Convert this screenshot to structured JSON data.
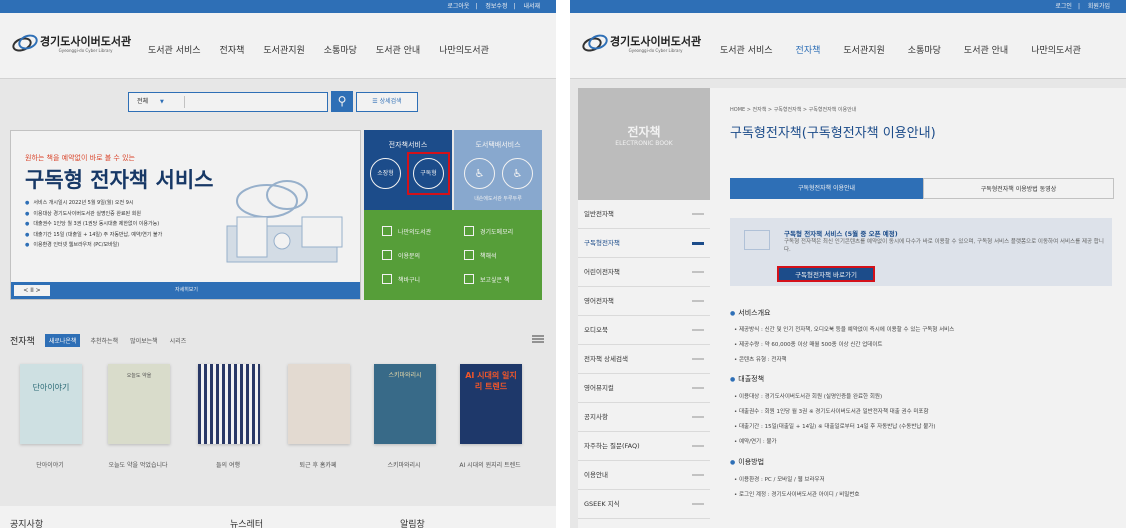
{
  "left": {
    "topbar": [
      "로그아웃",
      "정보수정",
      "내서재"
    ],
    "logo": {
      "name": "경기도사이버도서관",
      "sub": "Gyeonggi-do Cyber Library"
    },
    "gnb": [
      "도서관 서비스",
      "전자책",
      "도서관지원",
      "소통마당",
      "도서관 안내",
      "나만의도서관"
    ],
    "search": {
      "scope": "전체",
      "advanced": "상세검색"
    },
    "banner": {
      "kicker": "원하는 책을 예약없이 바로 볼 수 있는",
      "title": "구독형 전자책 서비스",
      "bullets": [
        "서비스 개시일시 2022년 5월 9일(월) 오전 9시",
        "이용대상 경기도사이버도서관 실명인증 완료된 회원",
        "대출권수 1인당 월 3권 (1권당 동시대출 제한없이 이용가능)",
        "대출기간 15일 (대출일 + 14일) 주 자동반납, 예약/연기 불가",
        "이용환경 인터넷 웹브라우저 (PC/모바일)"
      ],
      "nav": "< II >",
      "more": "자세히보기"
    },
    "ebook_service": {
      "title": "전자책서비스",
      "btn1": "소장형",
      "btn2": "구독형"
    },
    "delivery": {
      "title": "도서택배서비스",
      "caption": "내손에도서관  두루두루"
    },
    "quick": [
      "나만의도서관",
      "경기도메모리",
      "이용문의",
      "책해석",
      "책바구니",
      "보고싶은 책"
    ],
    "books_section": {
      "heading": "전자책",
      "tabs": [
        "새로나온책",
        "추천하는책",
        "많이보는책",
        "시리즈"
      ],
      "titles": [
        "단아이야기",
        "오늘도 약을 먹었습니다",
        "들의 여행",
        "퇴근 후 홈카페",
        "스키마와리시",
        "AI 시대의 윈지리 트렌드"
      ],
      "covers": [
        "단아이야기",
        "오늘도 약을",
        "",
        "",
        "스키마와리시",
        "AI 시대의 일지리 트렌드"
      ]
    },
    "bottom": [
      "공지사항",
      "뉴스레터",
      "알림창"
    ]
  },
  "right": {
    "topbar": [
      "로그인",
      "회원가입"
    ],
    "logo": {
      "name": "경기도사이버도서관",
      "sub": "Gyeonggi-do Cyber Library"
    },
    "gnb": [
      "도서관 서비스",
      "전자책",
      "도서관지원",
      "소통마당",
      "도서관 안내",
      "나만의도서관"
    ],
    "side": {
      "title": "전자책",
      "sub": "ELECTRONIC BOOK",
      "items": [
        "일반전자책",
        "구독형전자책",
        "어린이전자책",
        "영어전자책",
        "오디오북",
        "전자책 상세검색",
        "영어뮤지컬",
        "공지사항",
        "자주하는 질문(FAQ)",
        "이용안내",
        "GSEEK 지식"
      ]
    },
    "breadcrumb": "HOME > 전자책 > 구독형전자책 > 구독형전자책 이용안내",
    "title": "구독형전자책(구독형전자책 이용안내)",
    "tabs": [
      "구독형전자책 이용안내",
      "구독형전자책 이용방법 동영상"
    ],
    "notice": {
      "headline": "구독형 전자책 서비스 (5월 중 오픈 예정)",
      "body": "구독형 전자책은 최신 인기콘텐츠를 예약없이 동시에 다수가 바로 이용할 수 있으며, 구독형 서비스 플랫폼으로 이동하여 서비스를 제공 합니다.",
      "button": "구독형전자책 바로가기"
    },
    "sections": [
      {
        "title": "서비스개요",
        "items": [
          "제공방식 : 신간 및 인기 전자책, 오디오북 등을 예약없이 즉시에 이용할 수 있는 구독형 서비스",
          "제공수량 : 약 60,000종 이상 매월 500종 이상 신간 업데이트",
          "콘텐츠 유형 : 전자책"
        ]
      },
      {
        "title": "대출정책",
        "items": [
          "이용대상 : 경기도사이버도서관 회원 (실명인증을 완료한 회원)",
          "대출권수 : 회원 1인당 월 3권   ※ 경기도사이버도서관 일반전자책 대출 권수 미포함",
          "대출기간 : 15일(대출일 + 14일) ※ 대출일로부터 14일 후 자동반납 (수동반납 불가)",
          "예약/연기 : 불가"
        ]
      },
      {
        "title": "이용방법",
        "items": [
          "이용환경 : PC / 모바일 / 웹 브라우저",
          "로그인 계정 : 경기도사이버도서관 아이디 / 비밀번호"
        ]
      }
    ]
  },
  "colors": {
    "primary": "#2f74c0",
    "dark": "#1c4f91",
    "highlight": "#e0101a",
    "green": "#5aa63b"
  }
}
